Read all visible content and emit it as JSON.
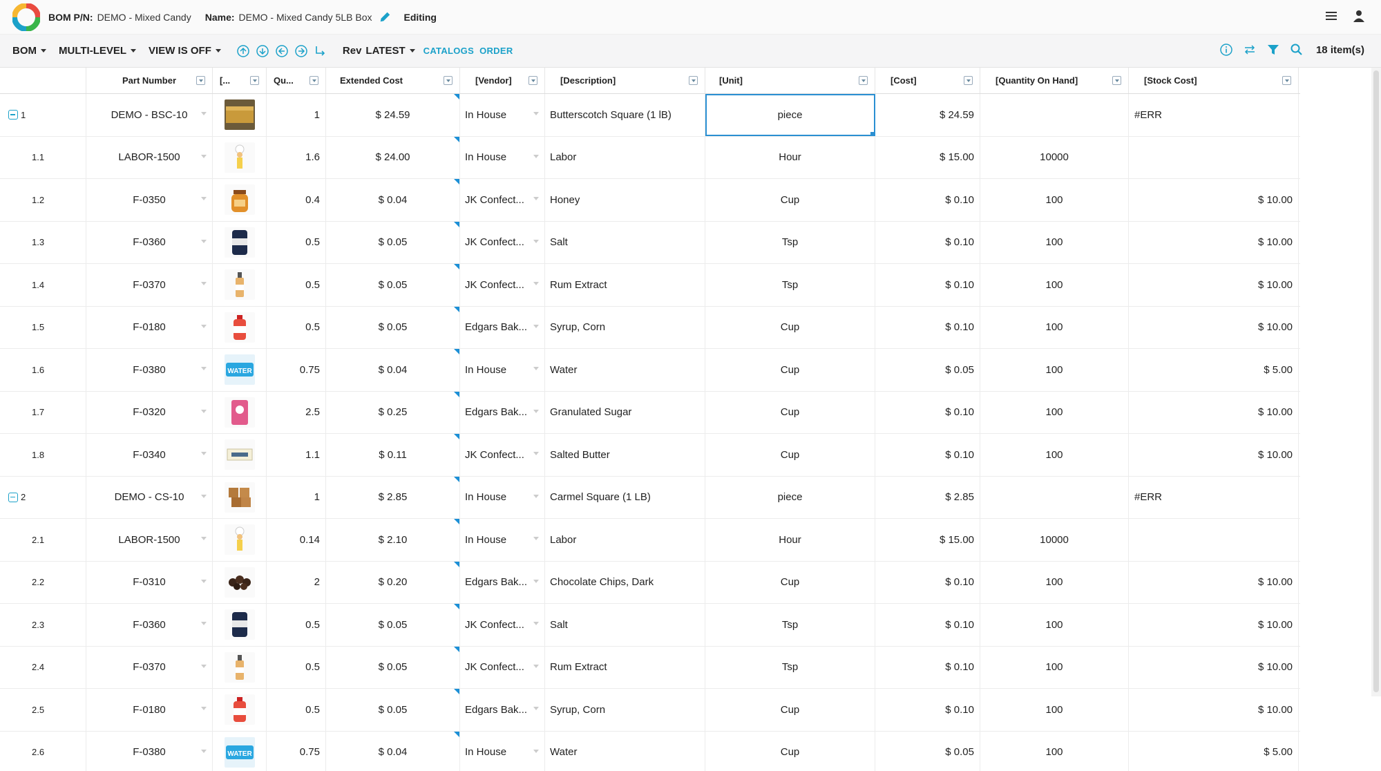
{
  "header": {
    "bom_label": "BOM P/N:",
    "bom_value": "DEMO - Mixed Candy",
    "name_label": "Name:",
    "name_value": "DEMO - Mixed Candy 5LB Box",
    "status": "Editing"
  },
  "toolbar": {
    "bom": "BOM",
    "multi_level": "MULTI-LEVEL",
    "view": "VIEW IS OFF",
    "rev_label": "Rev",
    "rev_value": "LATEST",
    "catalogs": "CATALOGS",
    "order": "ORDER",
    "count": "18 item(s)"
  },
  "columns": {
    "part": "Part Number",
    "img": "[...",
    "qty": "Qu...",
    "ext": "Extended Cost",
    "vendor": "[Vendor]",
    "desc": "[Description]",
    "unit": "[Unit]",
    "cost": "[Cost]",
    "qoh": "[Quantity On Hand]",
    "stock": "[Stock Cost]"
  },
  "rows": [
    {
      "idx": "1",
      "part": "DEMO - BSC-10",
      "img": "butterscotch-thumb",
      "qty": "1",
      "ext": "$ 24.59",
      "vendor": "In House",
      "desc": "Butterscotch Square (1 lB)",
      "unit": "piece",
      "cost": "$ 24.59",
      "qoh": "",
      "stock": "#ERR"
    },
    {
      "idx": "1.1",
      "part": "LABOR-1500",
      "img": "chef-thumb",
      "qty": "1.6",
      "ext": "$ 24.00",
      "vendor": "In House",
      "desc": "Labor",
      "unit": "Hour",
      "cost": "$ 15.00",
      "qoh": "10000",
      "stock": ""
    },
    {
      "idx": "1.2",
      "part": "F-0350",
      "img": "honey-thumb",
      "qty": "0.4",
      "ext": "$ 0.04",
      "vendor": "JK Confect...",
      "desc": "Honey",
      "unit": "Cup",
      "cost": "$ 0.10",
      "qoh": "100",
      "stock": "$ 10.00"
    },
    {
      "idx": "1.3",
      "part": "F-0360",
      "img": "salt-thumb",
      "qty": "0.5",
      "ext": "$ 0.05",
      "vendor": "JK Confect...",
      "desc": "Salt",
      "unit": "Tsp",
      "cost": "$ 0.10",
      "qoh": "100",
      "stock": "$ 10.00"
    },
    {
      "idx": "1.4",
      "part": "F-0370",
      "img": "extract-thumb",
      "qty": "0.5",
      "ext": "$ 0.05",
      "vendor": "JK Confect...",
      "desc": "Rum Extract",
      "unit": "Tsp",
      "cost": "$ 0.10",
      "qoh": "100",
      "stock": "$ 10.00"
    },
    {
      "idx": "1.5",
      "part": "F-0180",
      "img": "syrup-thumb",
      "qty": "0.5",
      "ext": "$ 0.05",
      "vendor": "Edgars Bak...",
      "desc": "Syrup, Corn",
      "unit": "Cup",
      "cost": "$ 0.10",
      "qoh": "100",
      "stock": "$ 10.00"
    },
    {
      "idx": "1.6",
      "part": "F-0380",
      "img": "water-thumb",
      "qty": "0.75",
      "ext": "$ 0.04",
      "vendor": "In House",
      "desc": "Water",
      "unit": "Cup",
      "cost": "$ 0.05",
      "qoh": "100",
      "stock": "$ 5.00"
    },
    {
      "idx": "1.7",
      "part": "F-0320",
      "img": "sugar-thumb",
      "qty": "2.5",
      "ext": "$ 0.25",
      "vendor": "Edgars Bak...",
      "desc": "Granulated Sugar",
      "unit": "Cup",
      "cost": "$ 0.10",
      "qoh": "100",
      "stock": "$ 10.00"
    },
    {
      "idx": "1.8",
      "part": "F-0340",
      "img": "butter-thumb",
      "qty": "1.1",
      "ext": "$ 0.11",
      "vendor": "JK Confect...",
      "desc": "Salted Butter",
      "unit": "Cup",
      "cost": "$ 0.10",
      "qoh": "100",
      "stock": "$ 10.00"
    },
    {
      "idx": "2",
      "part": "DEMO - CS-10",
      "img": "caramel-thumb",
      "qty": "1",
      "ext": "$ 2.85",
      "vendor": "In House",
      "desc": "Carmel Square (1 LB)",
      "unit": "piece",
      "cost": "$ 2.85",
      "qoh": "",
      "stock": "#ERR"
    },
    {
      "idx": "2.1",
      "part": "LABOR-1500",
      "img": "chef-thumb",
      "qty": "0.14",
      "ext": "$ 2.10",
      "vendor": "In House",
      "desc": "Labor",
      "unit": "Hour",
      "cost": "$ 15.00",
      "qoh": "10000",
      "stock": ""
    },
    {
      "idx": "2.2",
      "part": "F-0310",
      "img": "chips-thumb",
      "qty": "2",
      "ext": "$ 0.20",
      "vendor": "Edgars Bak...",
      "desc": "Chocolate Chips, Dark",
      "unit": "Cup",
      "cost": "$ 0.10",
      "qoh": "100",
      "stock": "$ 10.00"
    },
    {
      "idx": "2.3",
      "part": "F-0360",
      "img": "salt-thumb",
      "qty": "0.5",
      "ext": "$ 0.05",
      "vendor": "JK Confect...",
      "desc": "Salt",
      "unit": "Tsp",
      "cost": "$ 0.10",
      "qoh": "100",
      "stock": "$ 10.00"
    },
    {
      "idx": "2.4",
      "part": "F-0370",
      "img": "extract-thumb",
      "qty": "0.5",
      "ext": "$ 0.05",
      "vendor": "JK Confect...",
      "desc": "Rum Extract",
      "unit": "Tsp",
      "cost": "$ 0.10",
      "qoh": "100",
      "stock": "$ 10.00"
    },
    {
      "idx": "2.5",
      "part": "F-0180",
      "img": "syrup-thumb",
      "qty": "0.5",
      "ext": "$ 0.05",
      "vendor": "Edgars Bak...",
      "desc": "Syrup, Corn",
      "unit": "Cup",
      "cost": "$ 0.10",
      "qoh": "100",
      "stock": "$ 10.00"
    },
    {
      "idx": "2.6",
      "part": "F-0380",
      "img": "water-thumb",
      "qty": "0.75",
      "ext": "$ 0.04",
      "vendor": "In House",
      "desc": "Water",
      "unit": "Cup",
      "cost": "$ 0.05",
      "qoh": "100",
      "stock": "$ 5.00"
    }
  ],
  "thumb_water_text": "WATER",
  "colors": {
    "accent": "#1ba1c9",
    "selection": "#2a8fd2"
  }
}
